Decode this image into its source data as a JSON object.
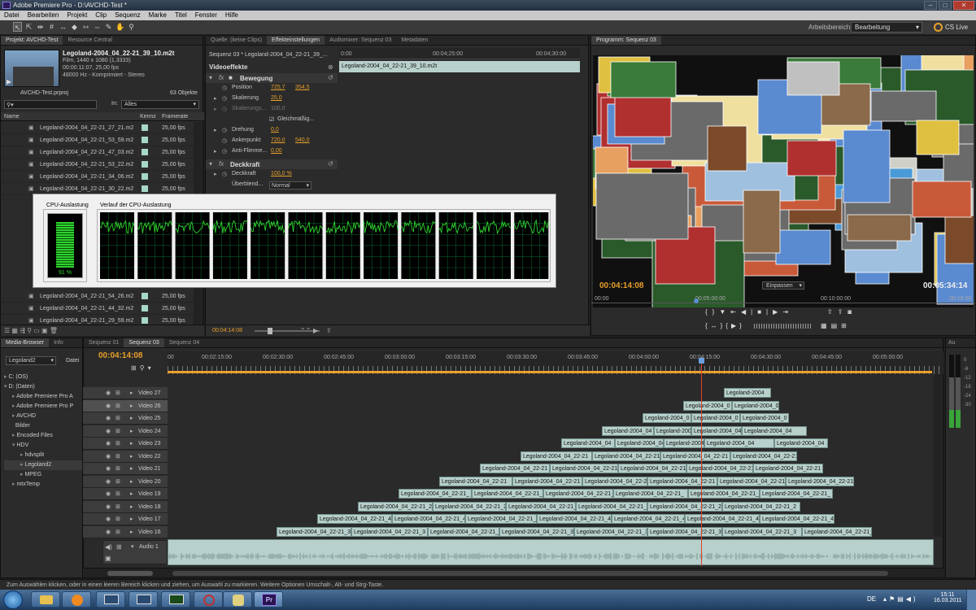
{
  "title": "Adobe Premiere Pro - D:\\AVCHD-Test *",
  "menu": [
    "Datei",
    "Bearbeiten",
    "Projekt",
    "Clip",
    "Sequenz",
    "Marke",
    "Titel",
    "Fenster",
    "Hilfe"
  ],
  "workspace": {
    "label": "Arbeitsbereich:",
    "value": "Bearbeitung",
    "cs_live": "CS Live"
  },
  "project": {
    "tabs": [
      "Projekt: AVCHD-Test",
      "Resource Central"
    ],
    "clip_name": "Legoland-2004_04_22-21_39_10.m2t",
    "clip_info": [
      "Film, 1440 x 1080 (1,3333)",
      "00:00:11:07, 25,00 fps",
      "48000 Hz - Komprimiert - Stereo"
    ],
    "project_file": "AVCHD-Test.prproj",
    "object_count": "63 Objekte",
    "search_in_label": "In:",
    "search_in_value": "Alles",
    "columns": [
      "Name",
      "Kennz",
      "Framerate"
    ],
    "items": [
      {
        "name": "Legoland-2004_04_22-21_27_21.m2",
        "fps": "25,00 fps"
      },
      {
        "name": "Legoland-2004_04_22-21_53_59.m2",
        "fps": "25,00 fps"
      },
      {
        "name": "Legoland-2004_04_22-21_47_03.m2",
        "fps": "25,00 fps"
      },
      {
        "name": "Legoland-2004_04_22-21_53_22.m2",
        "fps": "25,00 fps"
      },
      {
        "name": "Legoland-2004_04_22-21_34_06.m2",
        "fps": "25,00 fps"
      },
      {
        "name": "Legoland-2004_04_22-21_30_22.m2",
        "fps": "25,00 fps"
      },
      {
        "name": "Legoland-2004_04_22-21_54_26.m2",
        "fps": "25,00 fps"
      },
      {
        "name": "Legoland-2004_04_22-21_44_32.m2",
        "fps": "25,00 fps"
      },
      {
        "name": "Legoland-2004_04_22-21_29_59.m2",
        "fps": "25,00 fps"
      }
    ]
  },
  "effects": {
    "tabs": [
      "Quelle: (keine Clips)",
      "Effekteinstellungen",
      "Audiomixer: Sequenz 03",
      "Metadaten"
    ],
    "sequence_label": "Sequenz 03 * Legoland-2004_04_22-21_39_...",
    "ruler": [
      "0:00",
      "00:04;25:00",
      "00:04;30:00"
    ],
    "clip_label": "Legoland-2004_04_22-21_39_10.m2t",
    "section": "Videoeffekte",
    "motion": "Bewegung",
    "position": {
      "label": "Position",
      "x": "725,7",
      "y": "354,5"
    },
    "scale": {
      "label": "Skalierung",
      "value": "25,0"
    },
    "scale_width": {
      "label": "Skalierungs...",
      "value": "100,0"
    },
    "uniform": "Gleichmäßig...",
    "rotation": {
      "label": "Drehung",
      "value": "0,0"
    },
    "anchor": {
      "label": "Ankerpunkt",
      "x": "720,0",
      "y": "540,0"
    },
    "antiflicker": {
      "label": "Anti-Flimme...",
      "value": "0,00"
    },
    "opacity": "Deckkraft",
    "opacity_value": {
      "label": "Deckkraft",
      "value": "100,0 %"
    },
    "blend": {
      "label": "Überblend...",
      "value": "Normal"
    },
    "timecode": "00:04:14:08"
  },
  "cpu": {
    "usage_title": "CPU-Auslastung",
    "history_title": "Verlauf der CPU-Auslastung",
    "percent": "91 %",
    "usage_fraction": 0.91,
    "cores": 12
  },
  "program": {
    "tab": "Programm: Sequenz 03",
    "timecode": "00:04:14:08",
    "fit": "Einpassen",
    "duration": "00:05:34:14",
    "ruler": [
      "00:00",
      "00:05:00:00",
      "00:10:00:00",
      "00:15:00"
    ]
  },
  "media_browser": {
    "tabs": [
      "Media-Browser",
      "Info"
    ],
    "dropdown": "Legoland2",
    "files_label": "Datei",
    "tree": [
      {
        "label": "C: (OS)",
        "depth": 0
      },
      {
        "label": "D: (Daten)",
        "depth": 0
      },
      {
        "label": "Adobe Premiere Pro A",
        "depth": 1
      },
      {
        "label": "Adobe Premiere Pro P",
        "depth": 1
      },
      {
        "label": "AVCHD",
        "depth": 1
      },
      {
        "label": "Bilder",
        "depth": 1
      },
      {
        "label": "Encoded Files",
        "depth": 1
      },
      {
        "label": "HDV",
        "depth": 1
      },
      {
        "label": "hdvsplit",
        "depth": 2
      },
      {
        "label": "Legoland2",
        "depth": 2
      },
      {
        "label": "MPEG",
        "depth": 2
      },
      {
        "label": "mtxTemp",
        "depth": 1
      }
    ]
  },
  "timeline": {
    "tabs": [
      "Sequenz 01",
      "Sequenz 03",
      "Sequenz 04"
    ],
    "timecode": "00:04:14:08",
    "ruler": [
      "00:02:15:00",
      "00:02:30:00",
      "00:02:45:00",
      "00:03:00:00",
      "00:03:15:00",
      "00:03:30:00",
      "00:03:45:00",
      "00:04:00:00",
      "00:04:15:00",
      "00:04:30:00",
      "00:04:45:00",
      "00:05:00:00"
    ],
    "ruler_start": "00",
    "tracks": [
      "Video 27",
      "Video 26",
      "Video 25",
      "Video 24",
      "Video 23",
      "Video 22",
      "Video 21",
      "Video 20",
      "Video 19",
      "Video 18",
      "Video 17",
      "Video 16"
    ],
    "audio_track": "Audio 1",
    "clip_labels": {
      "short": "Legoland-2004",
      "mid": "Legoland-2004_0",
      "a": "Legoland-2004_04",
      "b": "Legoland-2004_04_22-21",
      "c": "Legoland-2004_04_22-21_3",
      "d": "Legoland-2004_04_22-21_",
      "e": "Legoland-2004_04_22-21_4",
      "f": "Legoland-2004_04_22-21_2"
    }
  },
  "audio_meter": {
    "tab": "Au",
    "scale": [
      "0",
      "-6",
      "-12",
      "-18",
      "-24",
      "-30"
    ]
  },
  "status_text": "Zum Auswählen klicken, oder in einen leeren Bereich klicken und ziehen, um Auswahl zu markieren. Weitere Optionen Umschalt-, Alt- und Strg-Taste.",
  "taskbar": {
    "lang": "DE",
    "time": "15:11",
    "date": "16.03.2011",
    "pr_label": "Pr"
  },
  "colors": {
    "accent": "#e8a02c",
    "clip": "#b8d0cc",
    "cpu_green": "#2ed42e",
    "playhead": "#e0402a"
  }
}
